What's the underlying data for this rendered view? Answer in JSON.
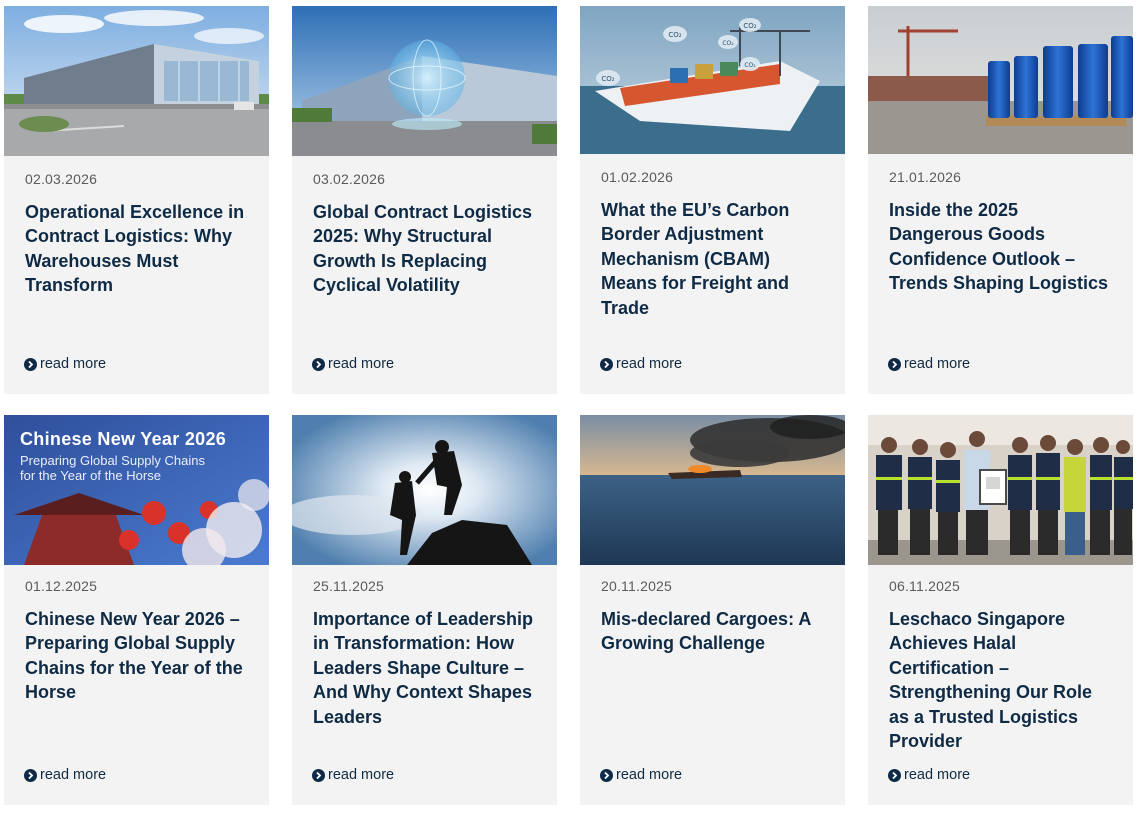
{
  "read_more_label": "read more",
  "cards": [
    {
      "date": "02.03.2026",
      "title": "Operational Excellence in Contract Logistics: Why Warehouses Must Transform",
      "image": "modern-warehouse-building"
    },
    {
      "date": "03.02.2026",
      "title": "Global Contract Logistics 2025: Why Structural Growth Is Replacing Cyclical Volatility",
      "image": "warehouse-with-globe-hologram"
    },
    {
      "date": "01.02.2026",
      "title": "What the EU’s Carbon Border Adjustment Mechanism (CBAM) Means for Freight and Trade",
      "image": "container-ship-co2-clouds",
      "image_labels": [
        "CO₂",
        "CO₂",
        "CO₂",
        "CO₂",
        "CO₂"
      ]
    },
    {
      "date": "21.01.2026",
      "title": "Inside the 2025 Dangerous Goods Confidence Outlook – Trends Shaping Logistics",
      "image": "blue-drums-at-port"
    },
    {
      "date": "01.12.2025",
      "title": "Chinese New Year 2026 – Preparing Global Supply Chains for the Year of the Horse",
      "image": "chinese-new-year-banner",
      "image_title": "Chinese New Year 2026",
      "image_subtitle_1": "Preparing Global Supply Chains",
      "image_subtitle_2": "for the Year of the Horse"
    },
    {
      "date": "25.11.2025",
      "title": "Importance of Leadership in Transformation: How Leaders Shape Culture – And Why Context Shapes Leaders",
      "image": "climbers-helping-silhouette"
    },
    {
      "date": "20.11.2025",
      "title": "Mis-declared Cargoes: A Growing Challenge",
      "image": "burning-ship-at-sea"
    },
    {
      "date": "06.11.2025",
      "title": "Leschaco Singapore Achieves Halal Certification – Strengthening Our Role as a Trusted Logistics Provider",
      "image": "team-with-certificate"
    }
  ]
}
